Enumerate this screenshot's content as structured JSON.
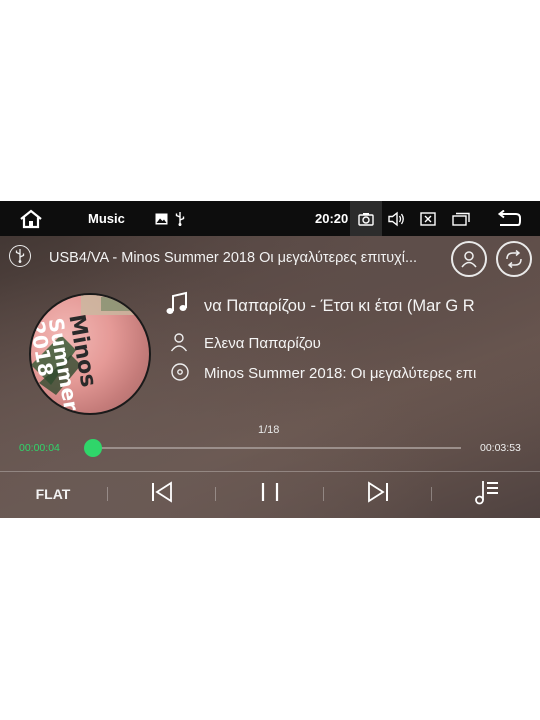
{
  "statusbar": {
    "app_title": "Music",
    "time": "20:20",
    "icons": [
      "home-icon",
      "gallery-icon",
      "usb-icon",
      "camera-icon",
      "volume-icon",
      "close-box-icon",
      "window-icon",
      "back-icon"
    ]
  },
  "source": {
    "icon": "usb-icon",
    "text": "USB4/VA - Minos Summer 2018 Οι μεγαλύτερες επιτυχί...",
    "right_buttons": [
      "account-icon",
      "repeat-icon"
    ]
  },
  "album_art": {
    "text_line1": "Minos",
    "text_line2": "Summer",
    "text_line3": "2018"
  },
  "now_playing": {
    "title": "να Παπαρίζου - Έτσι κι έτσι (Mar G R",
    "artist": "Ελενα Παπαρίζου",
    "album": "Minos Summer 2018: Οι μεγαλύτερες επι"
  },
  "playback": {
    "track_position": "1/18",
    "elapsed": "00:00:04",
    "duration": "00:03:53",
    "progress_fraction": 0.017,
    "accent_color": "#2fd66a"
  },
  "controls": {
    "eq_label": "FLAT",
    "buttons": [
      "previous-icon",
      "pause-icon",
      "next-icon",
      "playlist-icon"
    ]
  }
}
